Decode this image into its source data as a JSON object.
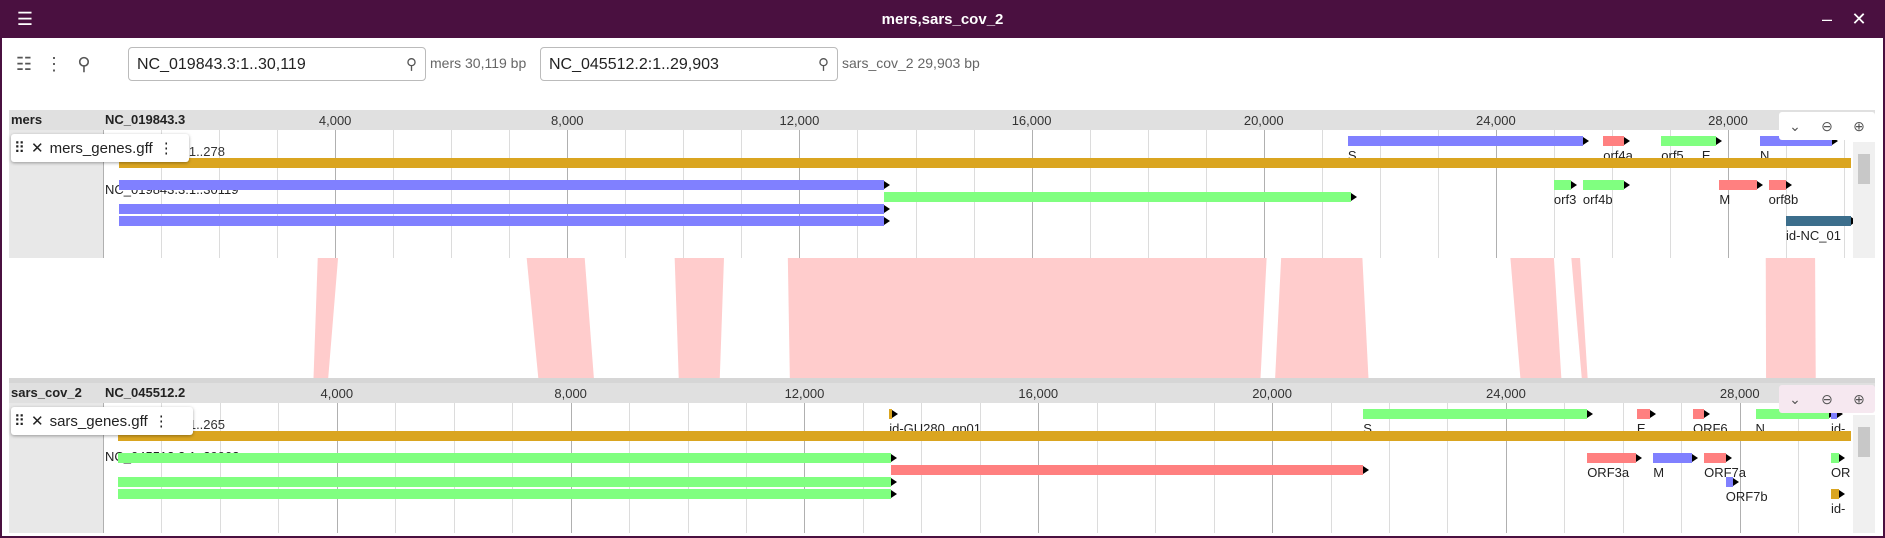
{
  "window": {
    "title": "mers,sars_cov_2"
  },
  "toolbar": {
    "loc1": "NC_019843.3:1..30,119",
    "info1": "mers 30,119 bp",
    "loc2": "NC_045512.2:1..29,903",
    "info2": "sars_cov_2 29,903 bp"
  },
  "colors": {
    "blue": "#8080ff",
    "green": "#80ff80",
    "red": "#ff8080",
    "gold": "#daa520",
    "teal": "#3c6e8c",
    "synteny": "#ffcccc",
    "titlebar": "#4a1040"
  },
  "mers": {
    "assembly": "mers",
    "refname": "NC_019843.3",
    "length": 30119,
    "ticks": [
      "4,000",
      "8,000",
      "12,000",
      "16,000",
      "20,000",
      "24,000",
      "28,000"
    ],
    "track_name": "mers_genes.gff",
    "region_label_a": "NC_019843.3:1..278",
    "region_label_b": "NC_019843.3:1..30119",
    "features": [
      {
        "start": 21450,
        "end": 25500,
        "row": 0,
        "color": "blue",
        "label": "S"
      },
      {
        "start": 25850,
        "end": 26200,
        "row": 0,
        "color": "red",
        "label": "orf4a"
      },
      {
        "start": 26850,
        "end": 27550,
        "row": 0,
        "color": "green",
        "label": "orf5"
      },
      {
        "start": 27550,
        "end": 27800,
        "row": 0,
        "color": "green",
        "label": "E"
      },
      {
        "start": 28550,
        "end": 29800,
        "row": 0,
        "color": "blue",
        "label": "N"
      },
      {
        "start": 280,
        "end": 30119,
        "row": 1,
        "color": "gold",
        "label": ""
      },
      {
        "start": 280,
        "end": 13450,
        "row": 3,
        "color": "blue",
        "label": ""
      },
      {
        "start": 13450,
        "end": 21500,
        "row": 4,
        "color": "green",
        "label": ""
      },
      {
        "start": 280,
        "end": 13450,
        "row": 5,
        "color": "blue",
        "label": ""
      },
      {
        "start": 280,
        "end": 13450,
        "row": 6,
        "color": "blue",
        "label": ""
      },
      {
        "start": 25000,
        "end": 25300,
        "row": 3,
        "color": "green",
        "label": "orf3"
      },
      {
        "start": 25500,
        "end": 26200,
        "row": 3,
        "color": "green",
        "label": "orf4b"
      },
      {
        "start": 27850,
        "end": 28500,
        "row": 3,
        "color": "red",
        "label": "M"
      },
      {
        "start": 28700,
        "end": 29000,
        "row": 3,
        "color": "red",
        "label": "orf8b"
      },
      {
        "start": 29000,
        "end": 30119,
        "row": 6,
        "color": "teal",
        "label": "id-NC_01"
      }
    ]
  },
  "sars": {
    "assembly": "sars_cov_2",
    "refname": "NC_045512.2",
    "length": 29903,
    "ticks": [
      "4,000",
      "8,000",
      "12,000",
      "16,000",
      "20,000",
      "24,000",
      "28,000"
    ],
    "track_name": "sars_genes.gff",
    "region_label_a": "NC_045512.2:1..265",
    "region_label_b": "NC_045512.2:1..29903",
    "features": [
      {
        "start": 13450,
        "end": 13480,
        "row": 0,
        "color": "gold",
        "label": "id-GU280_gp01"
      },
      {
        "start": 21560,
        "end": 25380,
        "row": 0,
        "color": "green",
        "label": "S"
      },
      {
        "start": 26240,
        "end": 26470,
        "row": 0,
        "color": "red",
        "label": "E"
      },
      {
        "start": 27200,
        "end": 27390,
        "row": 0,
        "color": "red",
        "label": "ORF6"
      },
      {
        "start": 28270,
        "end": 29530,
        "row": 0,
        "color": "green",
        "label": "N"
      },
      {
        "start": 29560,
        "end": 29670,
        "row": 0,
        "color": "blue",
        "label": "id-"
      },
      {
        "start": 265,
        "end": 29903,
        "row": 1,
        "color": "gold",
        "label": ""
      },
      {
        "start": 265,
        "end": 13480,
        "row": 3,
        "color": "green",
        "label": ""
      },
      {
        "start": 13480,
        "end": 21550,
        "row": 4,
        "color": "red",
        "label": ""
      },
      {
        "start": 265,
        "end": 13480,
        "row": 5,
        "color": "green",
        "label": ""
      },
      {
        "start": 265,
        "end": 13480,
        "row": 6,
        "color": "green",
        "label": ""
      },
      {
        "start": 25390,
        "end": 26220,
        "row": 3,
        "color": "red",
        "label": "ORF3a"
      },
      {
        "start": 26520,
        "end": 27190,
        "row": 3,
        "color": "blue",
        "label": "M"
      },
      {
        "start": 27390,
        "end": 27760,
        "row": 3,
        "color": "red",
        "label": "ORF7a"
      },
      {
        "start": 27760,
        "end": 27890,
        "row": 5,
        "color": "blue",
        "label": "ORF7b"
      },
      {
        "start": 29560,
        "end": 29700,
        "row": 3,
        "color": "green",
        "label": "OR"
      },
      {
        "start": 29560,
        "end": 29700,
        "row": 6,
        "color": "gold",
        "label": "id-"
      }
    ]
  },
  "synteny": [
    {
      "top_start": 3700,
      "top_end": 4050,
      "bot_start": 3600,
      "bot_end": 3850
    },
    {
      "top_start": 7300,
      "top_end": 8300,
      "bot_start": 7450,
      "bot_end": 8400
    },
    {
      "top_start": 9850,
      "top_end": 10700,
      "bot_start": 9850,
      "bot_end": 10550
    },
    {
      "top_start": 11800,
      "top_end": 20050,
      "bot_start": 11750,
      "bot_end": 19800
    },
    {
      "top_start": 20300,
      "top_end": 21700,
      "bot_start": 20050,
      "bot_end": 21650
    },
    {
      "top_start": 24250,
      "top_end": 25000,
      "bot_start": 24250,
      "bot_end": 24950
    },
    {
      "top_start": 25300,
      "top_end": 25450,
      "bot_start": 25300,
      "bot_end": 25400
    },
    {
      "top_start": 28650,
      "top_end": 29500,
      "bot_start": 28450,
      "bot_end": 29300
    }
  ]
}
